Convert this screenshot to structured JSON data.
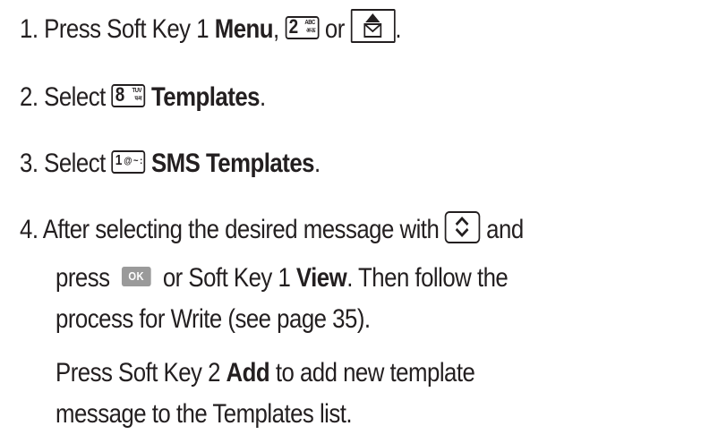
{
  "steps": [
    {
      "num": "1.",
      "pre": "Press Soft Key 1 ",
      "bold": "Menu",
      "mid": ",",
      "or": "or",
      "end": "."
    },
    {
      "num": "2.",
      "pre": "Select",
      "bold": "Templates",
      "end": "."
    },
    {
      "num": "3.",
      "pre": "Select",
      "bold": "SMS Templates",
      "end": "."
    },
    {
      "num": "4.",
      "pre": "After selecting the desired message with",
      "and": "and",
      "line2_pre": "press",
      "line2_or": "or Soft Key 1 ",
      "line2_bold": "View",
      "line2_end": ". Then follow the",
      "line3": "process for Write (see page 35)."
    }
  ],
  "note": {
    "pre": "Press Soft Key 2 ",
    "bold": "Add",
    "post": " to add new template",
    "line2": "message to the Templates list."
  },
  "keys": {
    "key2": {
      "digit": "2",
      "top": "ABC",
      "bottom": "अ-ऊ"
    },
    "key8": {
      "digit": "8",
      "top": "TUV",
      "bottom": "प-म"
    },
    "key1": {
      "digit": "1",
      "symbols": "@ ~ :"
    },
    "ok": {
      "label": "OK"
    }
  },
  "icons": {
    "message": "envelope-up-arrow-icon",
    "navigation": "up-down-navigation-icon"
  }
}
